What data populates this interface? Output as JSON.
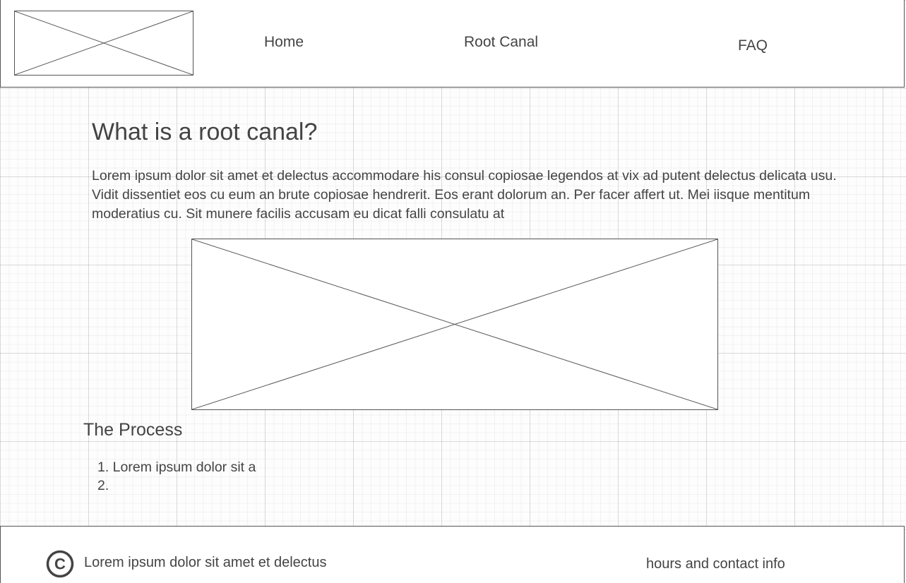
{
  "header": {
    "logo_icon": "image-placeholder-icon",
    "nav": {
      "home": "Home",
      "root_canal": "Root Canal",
      "faq": "FAQ"
    }
  },
  "main": {
    "title": "What is a root canal?",
    "intro": "Lorem ipsum dolor sit amet et delectus accommodare his consul copiosae legendos at vix ad putent delectus delicata usu. Vidit dissentiet eos cu eum an brute copiosae hendrerit. Eos erant dolorum an. Per facer affert ut. Mei iisque mentitum moderatius cu. Sit munere facilis accusam eu dicat falli consulatu at",
    "image_icon": "image-placeholder-icon",
    "process": {
      "title": "The Process",
      "steps": [
        "1. Lorem ipsum dolor sit a",
        "2."
      ]
    }
  },
  "footer": {
    "copyright_icon": "copyright-icon",
    "copyright_text": "Lorem ipsum dolor sit amet et delectus",
    "contact": "hours and contact info"
  }
}
